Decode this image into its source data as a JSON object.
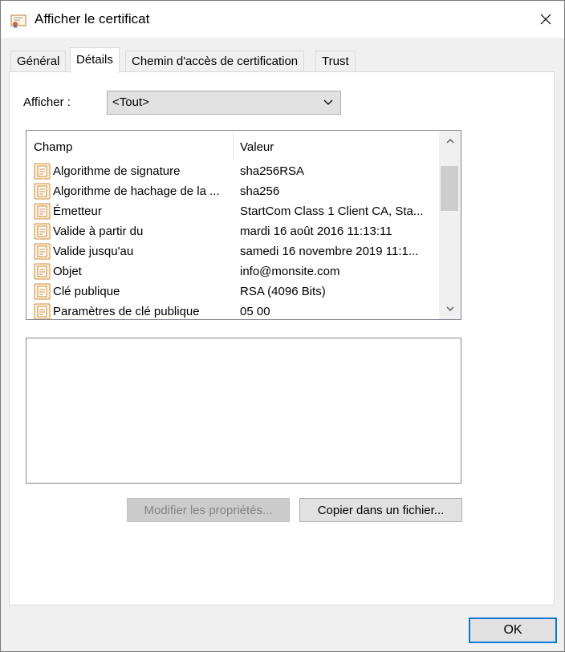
{
  "window": {
    "title": "Afficher le certificat"
  },
  "tabs": [
    {
      "label": "Général"
    },
    {
      "label": "Détails"
    },
    {
      "label": "Chemin d'accès de certification"
    },
    {
      "label": "Trust"
    }
  ],
  "details": {
    "show_label": "Afficher :",
    "show_value": "<Tout>",
    "columns": {
      "field": "Champ",
      "value": "Valeur"
    },
    "rows": [
      {
        "field": "Algorithme de signature",
        "value": "sha256RSA"
      },
      {
        "field": "Algorithme de hachage de la ...",
        "value": "sha256"
      },
      {
        "field": "Émetteur",
        "value": "StartCom Class 1 Client CA, Sta..."
      },
      {
        "field": "Valide à partir du",
        "value": "mardi 16 août 2016 11:13:11"
      },
      {
        "field": "Valide jusqu'au",
        "value": "samedi 16 novembre 2019 11:1..."
      },
      {
        "field": "Objet",
        "value": "info@monsite.com"
      },
      {
        "field": "Clé publique",
        "value": "RSA (4096 Bits)"
      },
      {
        "field": "Paramètres de clé publique",
        "value": "05 00"
      }
    ],
    "edit_button": "Modifier les propriétés...",
    "copy_button": "Copier dans un fichier..."
  },
  "ok_button": "OK",
  "colors": {
    "accent": "#0078d7",
    "cert_icon": "#e8a85a"
  }
}
